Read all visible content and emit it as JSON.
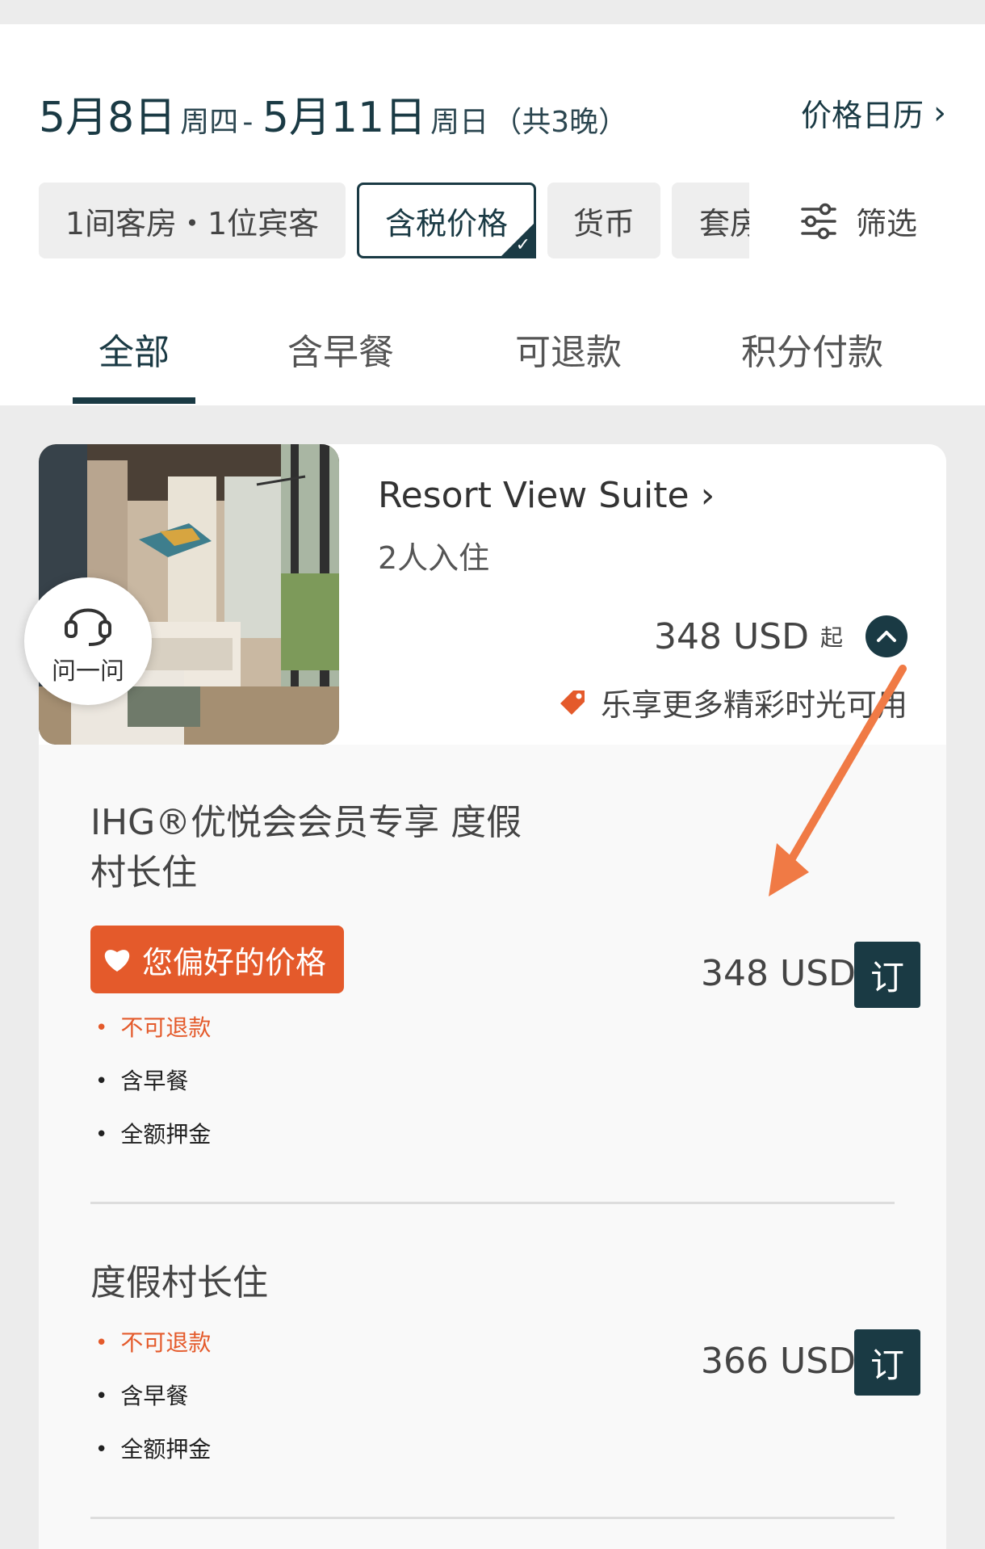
{
  "header": {
    "date_start": "5月8日",
    "date_start_weekday": "周四",
    "date_sep": " - ",
    "date_end": "5月11日",
    "date_end_weekday": "周日",
    "nights": "（共3晚）",
    "price_calendar": "价格日历"
  },
  "chips": {
    "rooms_guests": "1间客房・1位宾客",
    "tax_price": "含税价格",
    "currency": "货币",
    "package": "套房"
  },
  "filter_label": "筛选",
  "tabs": [
    "全部",
    "含早餐",
    "可退款",
    "积分付款"
  ],
  "room": {
    "name": "Resort View Suite",
    "occupancy": "2人入住",
    "from_price": "348 USD",
    "from_suffix": "起",
    "promo": "乐享更多精彩时光可用"
  },
  "rates": [
    {
      "title_line1": "IHG®优悦会会员专享 度假",
      "title_line2": "村长住",
      "badge": "您偏好的价格",
      "features": [
        "不可退款",
        "含早餐",
        "全额押金"
      ],
      "price": "348 USD",
      "book": "订"
    },
    {
      "title_line1": "度假村长住",
      "features": [
        "不可退款",
        "含早餐",
        "全额押金"
      ],
      "price": "366 USD",
      "book": "订"
    }
  ],
  "ask": "问一问",
  "colors": {
    "brand": "#1a3a44",
    "accent": "#e45a2b",
    "arrow": "#f07a45"
  }
}
